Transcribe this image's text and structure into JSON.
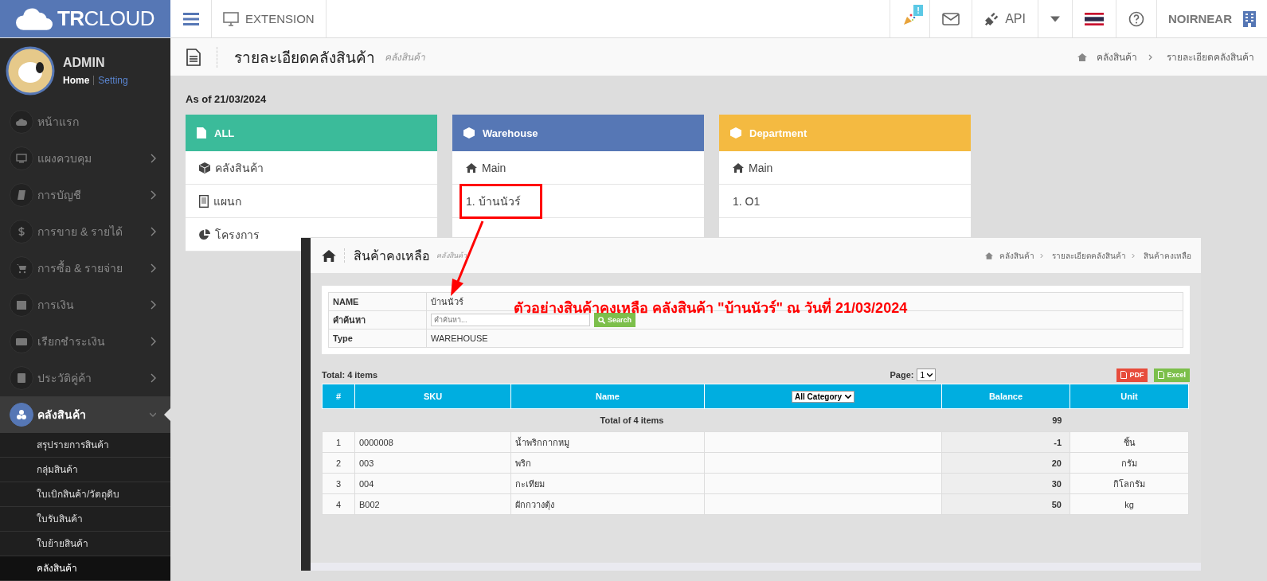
{
  "topbar": {
    "logo": "**TR**CLOUD",
    "extension": "EXTENSION",
    "badge": "!",
    "api": "API",
    "user": "NOIRNEAR"
  },
  "sidebar": {
    "user": "ADMIN",
    "links": [
      {
        "label": "Home",
        "selected": true
      },
      {
        "label": "Setting",
        "selected": false
      }
    ],
    "items": [
      {
        "label": "หน้าแรก",
        "has_children": false,
        "selected": false
      },
      {
        "label": "แผงควบคุม",
        "has_children": true,
        "selected": false
      },
      {
        "label": "การบัญชี",
        "has_children": true,
        "selected": false
      },
      {
        "label": "การขาย & รายได้",
        "has_children": true,
        "selected": false
      },
      {
        "label": "การซื้อ & รายจ่าย",
        "has_children": true,
        "selected": false
      },
      {
        "label": "การเงิน",
        "has_children": true,
        "selected": false
      },
      {
        "label": "เรียกชำระเงิน",
        "has_children": true,
        "selected": false
      },
      {
        "label": "ประวัติคู่ค้า",
        "has_children": true,
        "selected": false
      },
      {
        "label": "คลังสินค้า",
        "has_children": true,
        "selected": true,
        "expanded": true,
        "children": [
          {
            "label": "สรุปรายการสินค้า",
            "selected": false
          },
          {
            "label": "กลุ่มสินค้า",
            "selected": false
          },
          {
            "label": "ใบเบิกสินค้า/วัตถุดิบ",
            "selected": false
          },
          {
            "label": "ใบรับสินค้า",
            "selected": false
          },
          {
            "label": "ใบย้ายสินค้า",
            "selected": false
          },
          {
            "label": "คลังสินค้า",
            "selected": true
          }
        ]
      }
    ]
  },
  "page_header": {
    "title": "รายละเอียดคลังสินค้า",
    "subtitle": "คลังสินค้า",
    "breadcrumbs": [
      "คลังสินค้า",
      "รายละเอียดคลังสินค้า"
    ]
  },
  "as_of": "As of 21/03/2024",
  "cards": [
    {
      "title": "ALL",
      "color": "#3bbb9a",
      "rows": [
        {
          "text": "คลังสินค้า",
          "highlighted": false
        },
        {
          "text": "แผนก",
          "highlighted": false
        },
        {
          "text": "โครงการ",
          "highlighted": false
        }
      ]
    },
    {
      "title": "Warehouse",
      "color": "#5677b5",
      "rows": [
        {
          "text": "Main",
          "highlighted": false
        },
        {
          "text": "1. บ้านนัวร์",
          "highlighted": true
        }
      ]
    },
    {
      "title": "Department",
      "color": "#f4ba41",
      "rows": [
        {
          "text": "Main",
          "highlighted": false
        },
        {
          "text": "1. O1",
          "highlighted": false
        }
      ]
    }
  ],
  "overlay": {
    "title": "สินค้าคงเหลือ",
    "subtitle": "คลังสินค้า",
    "breadcrumbs": [
      "คลังสินค้า",
      "รายละเอียดคลังสินค้า",
      "สินค้าคงเหลือ"
    ],
    "info": [
      {
        "label": "NAME",
        "value": "บ้านนัวร์",
        "kind": "text"
      },
      {
        "label": "คำค้นหา",
        "placeholder": "คำค้นหา...",
        "button": "Search",
        "kind": "search"
      },
      {
        "label": "Type",
        "value": "WAREHOUSE",
        "kind": "text"
      }
    ],
    "total": "Total: 4 items",
    "page_label": "Page:",
    "page_value": "1",
    "pdf": "PDF",
    "excel": "Excel",
    "columns": [
      "#",
      "SKU",
      "Name",
      "All Category",
      "Balance",
      "Unit"
    ],
    "summary": {
      "label": "Total of 4 items",
      "balance": "99"
    },
    "rows": [
      {
        "no": "1",
        "sku": "0000008",
        "name": "น้ำพริกกากหมู",
        "balance": "-1",
        "unit": "ชิ้น"
      },
      {
        "no": "2",
        "sku": "003",
        "name": "พริก",
        "balance": "20",
        "unit": "กรัม"
      },
      {
        "no": "3",
        "sku": "004",
        "name": "กะเทียม",
        "balance": "30",
        "unit": "กิโลกรัม"
      },
      {
        "no": "4",
        "sku": "B002",
        "name": "ผักกวางตุ้ง",
        "balance": "50",
        "unit": "kg"
      }
    ]
  },
  "annotation": "ตัวอย่างสินค้าคงเหลือ คลังสินค้า \"บ้านนัวร์\" ณ วันที่ 21/03/2024"
}
